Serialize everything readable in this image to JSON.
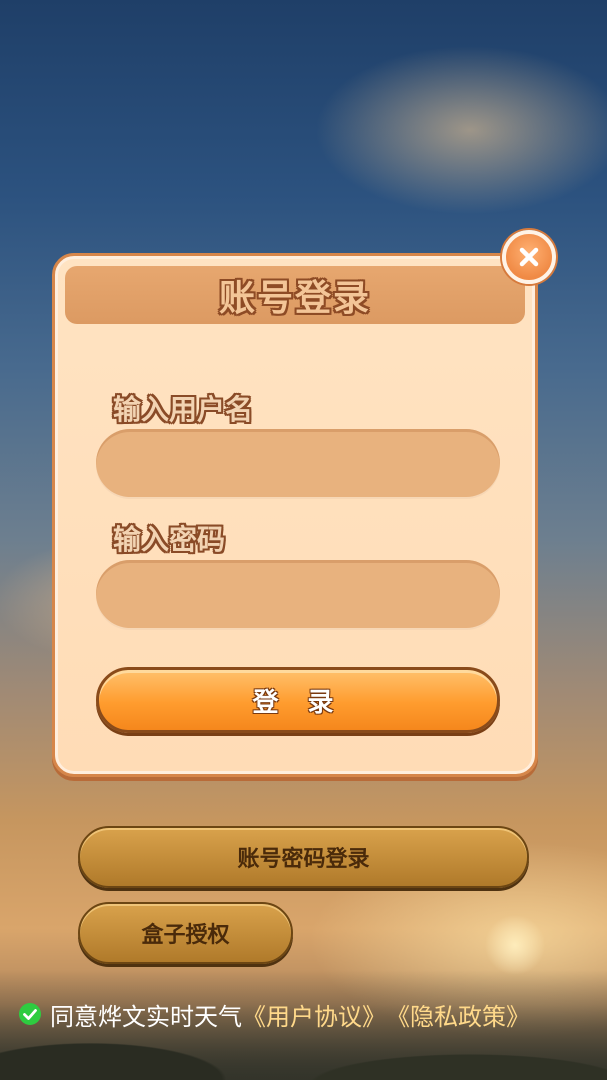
{
  "dialog": {
    "title": "账号登录",
    "close_icon": "close-icon",
    "username_label": "输入用户名",
    "password_label": "输入密码",
    "login_button": "登 录"
  },
  "actions": {
    "account_password_login": "账号密码登录",
    "box_authorize": "盒子授权"
  },
  "agreement": {
    "text": "同意烨文实时天气",
    "user_agreement": "《用户协议》",
    "privacy_policy": "《隐私政策》",
    "checked": true
  },
  "colors": {
    "dialog_bg": "#ffdcb6",
    "dialog_border": "#d6864a",
    "login_button": "#ff9c2e",
    "pill_button": "#c68f3c",
    "check_green": "#2ecc40"
  }
}
